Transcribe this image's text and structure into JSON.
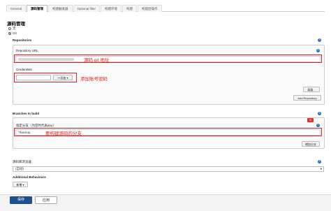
{
  "tabs": [
    "General",
    "源码管理",
    "构建触发器",
    "Optional filter",
    "构建环境",
    "构建",
    "构建后操作"
  ],
  "active_tab_index": 1,
  "section_title": "源码管理",
  "scm_options": [
    {
      "label": "无",
      "checked": false
    },
    {
      "label": "Git",
      "checked": true
    }
  ],
  "repositories": {
    "heading": "Repositories",
    "url_label": "Repository URL",
    "url_annotation": "源码 git 地址",
    "credentials_label": "Credentials",
    "credentials_selected": "- - - - - - - - - - - - - - - -",
    "add_button": "添加",
    "credentials_annotation": "添加账号密码",
    "advanced_button": "高级...",
    "add_repository_button": "Add Repository"
  },
  "branches": {
    "heading": "Branches to build",
    "specifier_label": "指定分支（为空时代表any）",
    "specifier_value": "*/backup",
    "annotation": "要构建源码的分支",
    "remove_button": "X",
    "add_branch_button": "增加分支"
  },
  "browser": {
    "label": "源码库浏览器",
    "selected": "(自动)"
  },
  "additional": {
    "label": "Additional Behaviours",
    "add_button": "新增"
  },
  "footer": {
    "save": "保存",
    "apply": "应用"
  }
}
